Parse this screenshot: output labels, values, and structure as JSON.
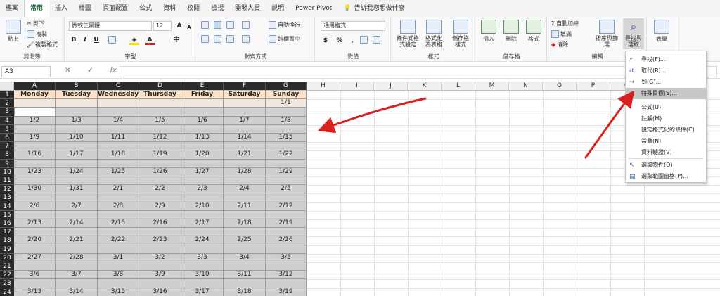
{
  "tabs": [
    "檔案",
    "常用",
    "插入",
    "繪圖",
    "頁面配置",
    "公式",
    "資料",
    "校閱",
    "檢視",
    "開發人員",
    "說明",
    "Power Pivot",
    "告訴我您想做什麼"
  ],
  "active_tab": "常用",
  "ribbon": {
    "clipboard": {
      "paste": "貼上",
      "cut": "剪下",
      "copy": "複製",
      "format_painter": "複製格式",
      "label": "剪貼簿"
    },
    "font": {
      "name": "微軟正黑體",
      "size": "12",
      "label": "字型"
    },
    "alignment": {
      "wrap": "自動換行",
      "merge": "跨欄置中",
      "label": "對齊方式"
    },
    "number": {
      "format": "通用格式",
      "label": "數值"
    },
    "styles": {
      "conditional": "條件式格式設定",
      "table": "格式化為表格",
      "cell": "儲存格樣式",
      "label": "樣式"
    },
    "cells": {
      "insert": "插入",
      "delete": "刪除",
      "format": "格式",
      "label": "儲存格"
    },
    "editing": {
      "autosum": "自動加總",
      "fill": "填滿",
      "clear": "清除",
      "sort": "排序與篩選",
      "find": "尋找與選取",
      "label": "編輯"
    },
    "form": {
      "label": "表單"
    }
  },
  "formula_bar": {
    "name_box": "A3",
    "cancel": "✕",
    "enter": "✓",
    "fx": "fx",
    "content": ""
  },
  "columns": [
    "A",
    "B",
    "C",
    "D",
    "E",
    "F",
    "G",
    "H",
    "I",
    "J",
    "K",
    "L",
    "M",
    "N",
    "O",
    "P",
    "Q"
  ],
  "rows": [
    "1",
    "2",
    "3",
    "4",
    "5",
    "6",
    "7",
    "8",
    "9",
    "10",
    "11",
    "12",
    "13",
    "14",
    "15",
    "16",
    "17",
    "18",
    "19",
    "20",
    "21",
    "22",
    "23",
    "24"
  ],
  "sheet": {
    "headers": [
      "Monday",
      "Tuesday",
      "Wednesday",
      "Thursday",
      "Friday",
      "Saturday",
      "Sunday"
    ],
    "row2_g": "1/1",
    "weeks": [
      [
        "1/2",
        "1/3",
        "1/4",
        "1/5",
        "1/6",
        "1/7",
        "1/8"
      ],
      [
        "1/9",
        "1/10",
        "1/11",
        "1/12",
        "1/13",
        "1/14",
        "1/15"
      ],
      [
        "1/16",
        "1/17",
        "1/18",
        "1/19",
        "1/20",
        "1/21",
        "1/22"
      ],
      [
        "1/23",
        "1/24",
        "1/25",
        "1/26",
        "1/27",
        "1/28",
        "1/29"
      ],
      [
        "1/30",
        "1/31",
        "2/1",
        "2/2",
        "2/3",
        "2/4",
        "2/5"
      ],
      [
        "2/6",
        "2/7",
        "2/8",
        "2/9",
        "2/10",
        "2/11",
        "2/12"
      ],
      [
        "2/13",
        "2/14",
        "2/15",
        "2/16",
        "2/17",
        "2/18",
        "2/19"
      ],
      [
        "2/20",
        "2/21",
        "2/22",
        "2/23",
        "2/24",
        "2/25",
        "2/26"
      ],
      [
        "2/27",
        "2/28",
        "3/1",
        "3/2",
        "3/3",
        "3/4",
        "3/5"
      ],
      [
        "3/6",
        "3/7",
        "3/8",
        "3/9",
        "3/10",
        "3/11",
        "3/12"
      ],
      [
        "3/13",
        "3/14",
        "3/15",
        "3/16",
        "3/17",
        "3/18",
        "3/19"
      ]
    ]
  },
  "find_menu": {
    "items": [
      {
        "label": "尋找(F)...",
        "icon": "search-icon"
      },
      {
        "label": "取代(R)...",
        "icon": "replace-icon"
      },
      {
        "label": "到(G)...",
        "icon": "goto-arrow-icon"
      },
      {
        "label": "特殊目標(S)...",
        "icon": "",
        "highlighted": true
      },
      {
        "label": "公式(U)",
        "icon": ""
      },
      {
        "label": "註解(M)",
        "icon": ""
      },
      {
        "label": "設定格式化的條件(C)",
        "icon": ""
      },
      {
        "label": "常數(N)",
        "icon": ""
      },
      {
        "label": "資料驗證(V)",
        "icon": ""
      },
      {
        "label": "選取物件(O)",
        "icon": "pointer-icon"
      },
      {
        "label": "選取範圍窗格(P)...",
        "icon": "selection-pane-icon"
      }
    ]
  },
  "colors": {
    "accent": "#1e6b3a",
    "header_fill": "#fbe2c9",
    "date_fill": "#cfcfcf",
    "annotation": "#d9201f"
  }
}
